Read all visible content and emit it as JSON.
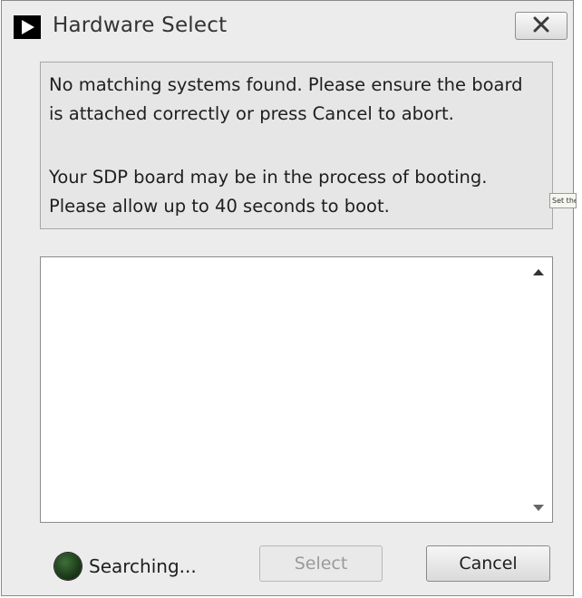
{
  "window": {
    "title": "Hardware Select",
    "app_icon": "play-arrow-icon",
    "close_icon": "close-icon"
  },
  "message": {
    "line1": "No matching systems found. Please ensure the board\nis attached correctly or press Cancel to abort.",
    "line2": "Your SDP board may be in the process of booting.\nPlease allow up to 40 seconds to boot."
  },
  "tooltip": {
    "text": "Set the"
  },
  "device_list": {
    "items": [],
    "scroll_up_icon": "scroll-up-arrow-icon",
    "scroll_down_icon": "scroll-down-arrow-icon"
  },
  "status": {
    "led_icon": "status-led-icon",
    "led_color": "#1e3f1b",
    "text": "Searching..."
  },
  "buttons": {
    "select_label": "Select",
    "cancel_label": "Cancel"
  }
}
